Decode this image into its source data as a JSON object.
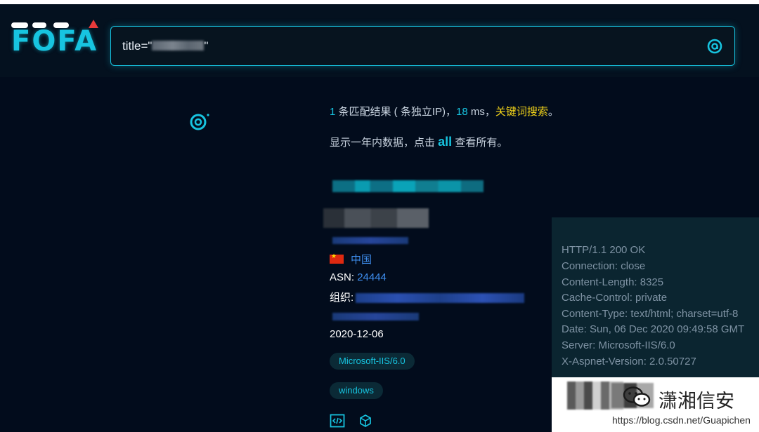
{
  "app": {
    "logo_text": "FOFA"
  },
  "search": {
    "query_prefix": "title=\"",
    "query_suffix": "\"",
    "button_icon": "search-at-icon"
  },
  "results": {
    "count": "1",
    "count_text": " 条匹配结果 ( 条独立IP)，",
    "time": "18",
    "time_unit": " ms，",
    "keyword_link": "关键词搜索",
    "period": "。",
    "note_prefix": "显示一年内数据，点击 ",
    "all_link": "all",
    "note_suffix": " 查看所有。"
  },
  "host": {
    "country": "中国",
    "asn_label": "ASN:",
    "asn_value": "24444",
    "org_label": "组织:",
    "date": "2020-12-06",
    "tags": [
      "Microsoft-IIS/6.0",
      "windows"
    ]
  },
  "http_header": {
    "lines": [
      "HTTP/1.1 200 OK",
      "Connection: close",
      "Content-Length: 8325",
      "Cache-Control: private",
      "Content-Type: text/html; charset=utf-8",
      "Date: Sun, 06 Dec 2020 09:49:58 GMT",
      "Server: Microsoft-IIS/6.0",
      "X-Aspnet-Version: 2.0.50727"
    ]
  },
  "watermark": {
    "name": "潇湘信安",
    "url": "https://blog.csdn.net/Guapichen"
  },
  "colors": {
    "accent": "#17c4e0",
    "keyword": "#f0d21a",
    "link": "#3f8ff0",
    "background": "#020c1c"
  }
}
